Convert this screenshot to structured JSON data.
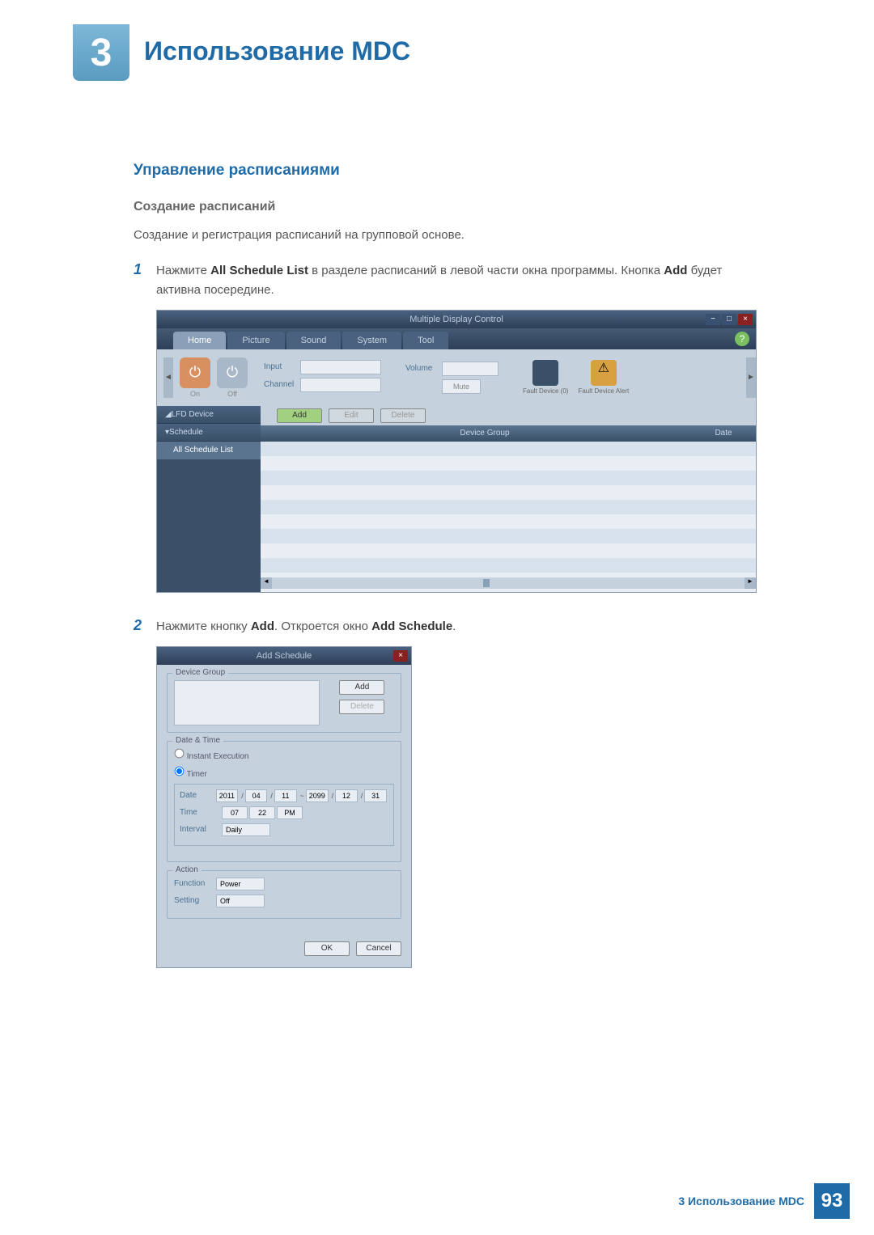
{
  "chapter": {
    "number": "3",
    "title": "Использование MDC"
  },
  "sections": {
    "h1": "Управление расписаниями",
    "h2": "Создание расписаний",
    "intro": "Создание и регистрация расписаний на групповой основе."
  },
  "steps": {
    "s1_pre": "Нажмите ",
    "s1_b1": "All Schedule List",
    "s1_mid": " в разделе расписаний в левой части окна программы. Кнопка ",
    "s1_b2": "Add",
    "s1_post": " будет активна посередине.",
    "s2_pre": "Нажмите кнопку ",
    "s2_b1": "Add",
    "s2_mid": ". Откроется окно ",
    "s2_b2": "Add Schedule",
    "s2_post": "."
  },
  "mdc_window": {
    "title": "Multiple Display Control",
    "tabs": [
      "Home",
      "Picture",
      "Sound",
      "System",
      "Tool"
    ],
    "power": {
      "on": "On",
      "off": "Off"
    },
    "inputs": {
      "input": "Input",
      "channel": "Channel",
      "volume": "Volume",
      "mute": "Mute"
    },
    "alerts": {
      "a1": "Fault Device\n(0)",
      "a2": "Fault Device\nAlert"
    },
    "sidebar": {
      "lfd": "LFD Device",
      "schedule": "Schedule",
      "all": "All Schedule List"
    },
    "actions": {
      "add": "Add",
      "edit": "Edit",
      "delete": "Delete"
    },
    "table": {
      "device_group": "Device Group",
      "date": "Date"
    }
  },
  "add_schedule": {
    "title": "Add Schedule",
    "device_group": "Device Group",
    "add": "Add",
    "delete": "Delete",
    "date_time": "Date & Time",
    "instant": "Instant Execution",
    "timer": "Timer",
    "date_label": "Date",
    "time_label": "Time",
    "interval_label": "Interval",
    "date_from": [
      "2011",
      "04",
      "11"
    ],
    "date_to": [
      "2099",
      "12",
      "31"
    ],
    "time": [
      "07",
      "22",
      "PM"
    ],
    "interval": "Daily",
    "action": "Action",
    "function_label": "Function",
    "setting_label": "Setting",
    "function": "Power",
    "setting": "Off",
    "ok": "OK",
    "cancel": "Cancel"
  },
  "footer": {
    "text": "3 Использование MDC",
    "page": "93"
  }
}
